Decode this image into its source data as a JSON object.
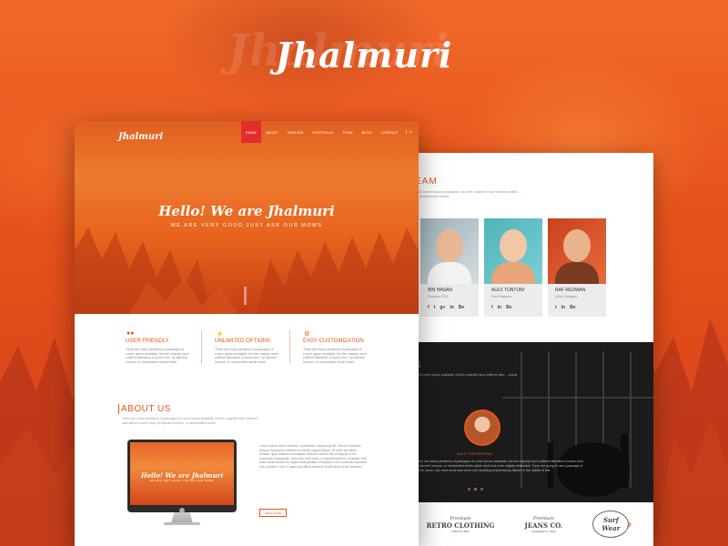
{
  "brand": {
    "title": "Jhalmuri",
    "accent": "#e8541c",
    "nav_active": "#e32d2d"
  },
  "hero": {
    "logo": "Jhalmuri",
    "nav": [
      "HOME",
      "ABOUT",
      "SERVICE",
      "PORTFOLIO",
      "TEAM",
      "BLOG",
      "CONTACT"
    ],
    "nav_active_index": 0,
    "nav_separator": "|",
    "headline": "Hello! We are Jhalmuri",
    "tagline": "WE ARE VERY GOOD JUST ASK OUR MOMS"
  },
  "features": [
    {
      "icon": "users-icon",
      "title": "USER FRIENDLY",
      "text": "There are many variations of passages of Lorem Ipsum available, but the majority have suffered alteration in some form, by injected humour, or randomised words which"
    },
    {
      "icon": "bolt-icon",
      "title": "UNLIMITED OPTIONS",
      "text": "There are many variations of passages of Lorem Ipsum available, but the majority have suffered alteration in some form, by injected humour, or randomised words which"
    },
    {
      "icon": "gears-icon",
      "title": "EASY CUSTOMIZATION",
      "text": "There are many variations of passages of Lorem Ipsum available, but the majority have suffered alteration in some form, by injected humour, or randomised words which"
    }
  ],
  "about": {
    "title": "ABOUT US",
    "subtitle": "There are many variations of passages of Lorem Ipsum available, but the majority have suffered alter-ation in some form, by injected humour, or randomised words",
    "mini_headline": "Hello! We are Jhalmuri",
    "mini_tagline": "WE ARE VERY GOOD JUST ASK OUR MOMS",
    "text": "Lorem ipsum dolor sit amet, consectetur adipiscing elit. Sed do eiusmod tempor incididunt ut labore et dolore magna aliqua. Ut enim ad minim veniam, quis nostrud exercitation ullamco laboris nisi ut aliquip ex ea commodo consequat. Duis aute irure dolor in reprehenderit in voluptate velit esse cillum dolore eu fugiat nulla pariatur. Excepteur sint occaecat cupidatat non proident, sunt in culpa qui officia deserunt mollit anim id est laborum.",
    "button": "READ MORE"
  },
  "team": {
    "title": "EAM",
    "subtitle": "…of Lorem Ipsum available, but the majority have suffered alter-…or randomised words",
    "members": [
      {
        "name": "IBN HASAN",
        "role": "Founder, CEO",
        "socials": [
          "f",
          "t",
          "g+",
          "in",
          "Be"
        ]
      },
      {
        "name": "ALEX TUNTUNI",
        "role": "Print Designer",
        "socials": [
          "f",
          "in",
          "Be"
        ]
      },
      {
        "name": "RAF REDWAN",
        "role": "UI/UX Designer",
        "socials": [
          "t",
          "in",
          "Be"
        ]
      }
    ]
  },
  "testimonial": {
    "title": "S",
    "subtitle": "…of Lorem Ipsum available, but the majority have suffered alter-…words",
    "name": "ALEX TUNTUNI RAM",
    "quote": "There are many variations of passages of Lorem Ipsum available, but the majority have suffered alteration in some form, by injected humour, or randomised words which don't look even slightly believable. If you are going to use a passage of Lorem Ipsum, you need to be sure there isn't anything embarrassing hidden in the middle of text.",
    "active_slide": 1,
    "slides": 3
  },
  "clients": {
    "logos": [
      {
        "top": "Premium",
        "big": "RETRO CLOTHING",
        "small": "SINCE 1983"
      },
      {
        "top": "Premium",
        "big": "JEANS CO.",
        "small": "Designed by Web"
      },
      {
        "top": "Surf Wear",
        "big": "",
        "small": ""
      }
    ],
    "next_arrow": "›"
  }
}
